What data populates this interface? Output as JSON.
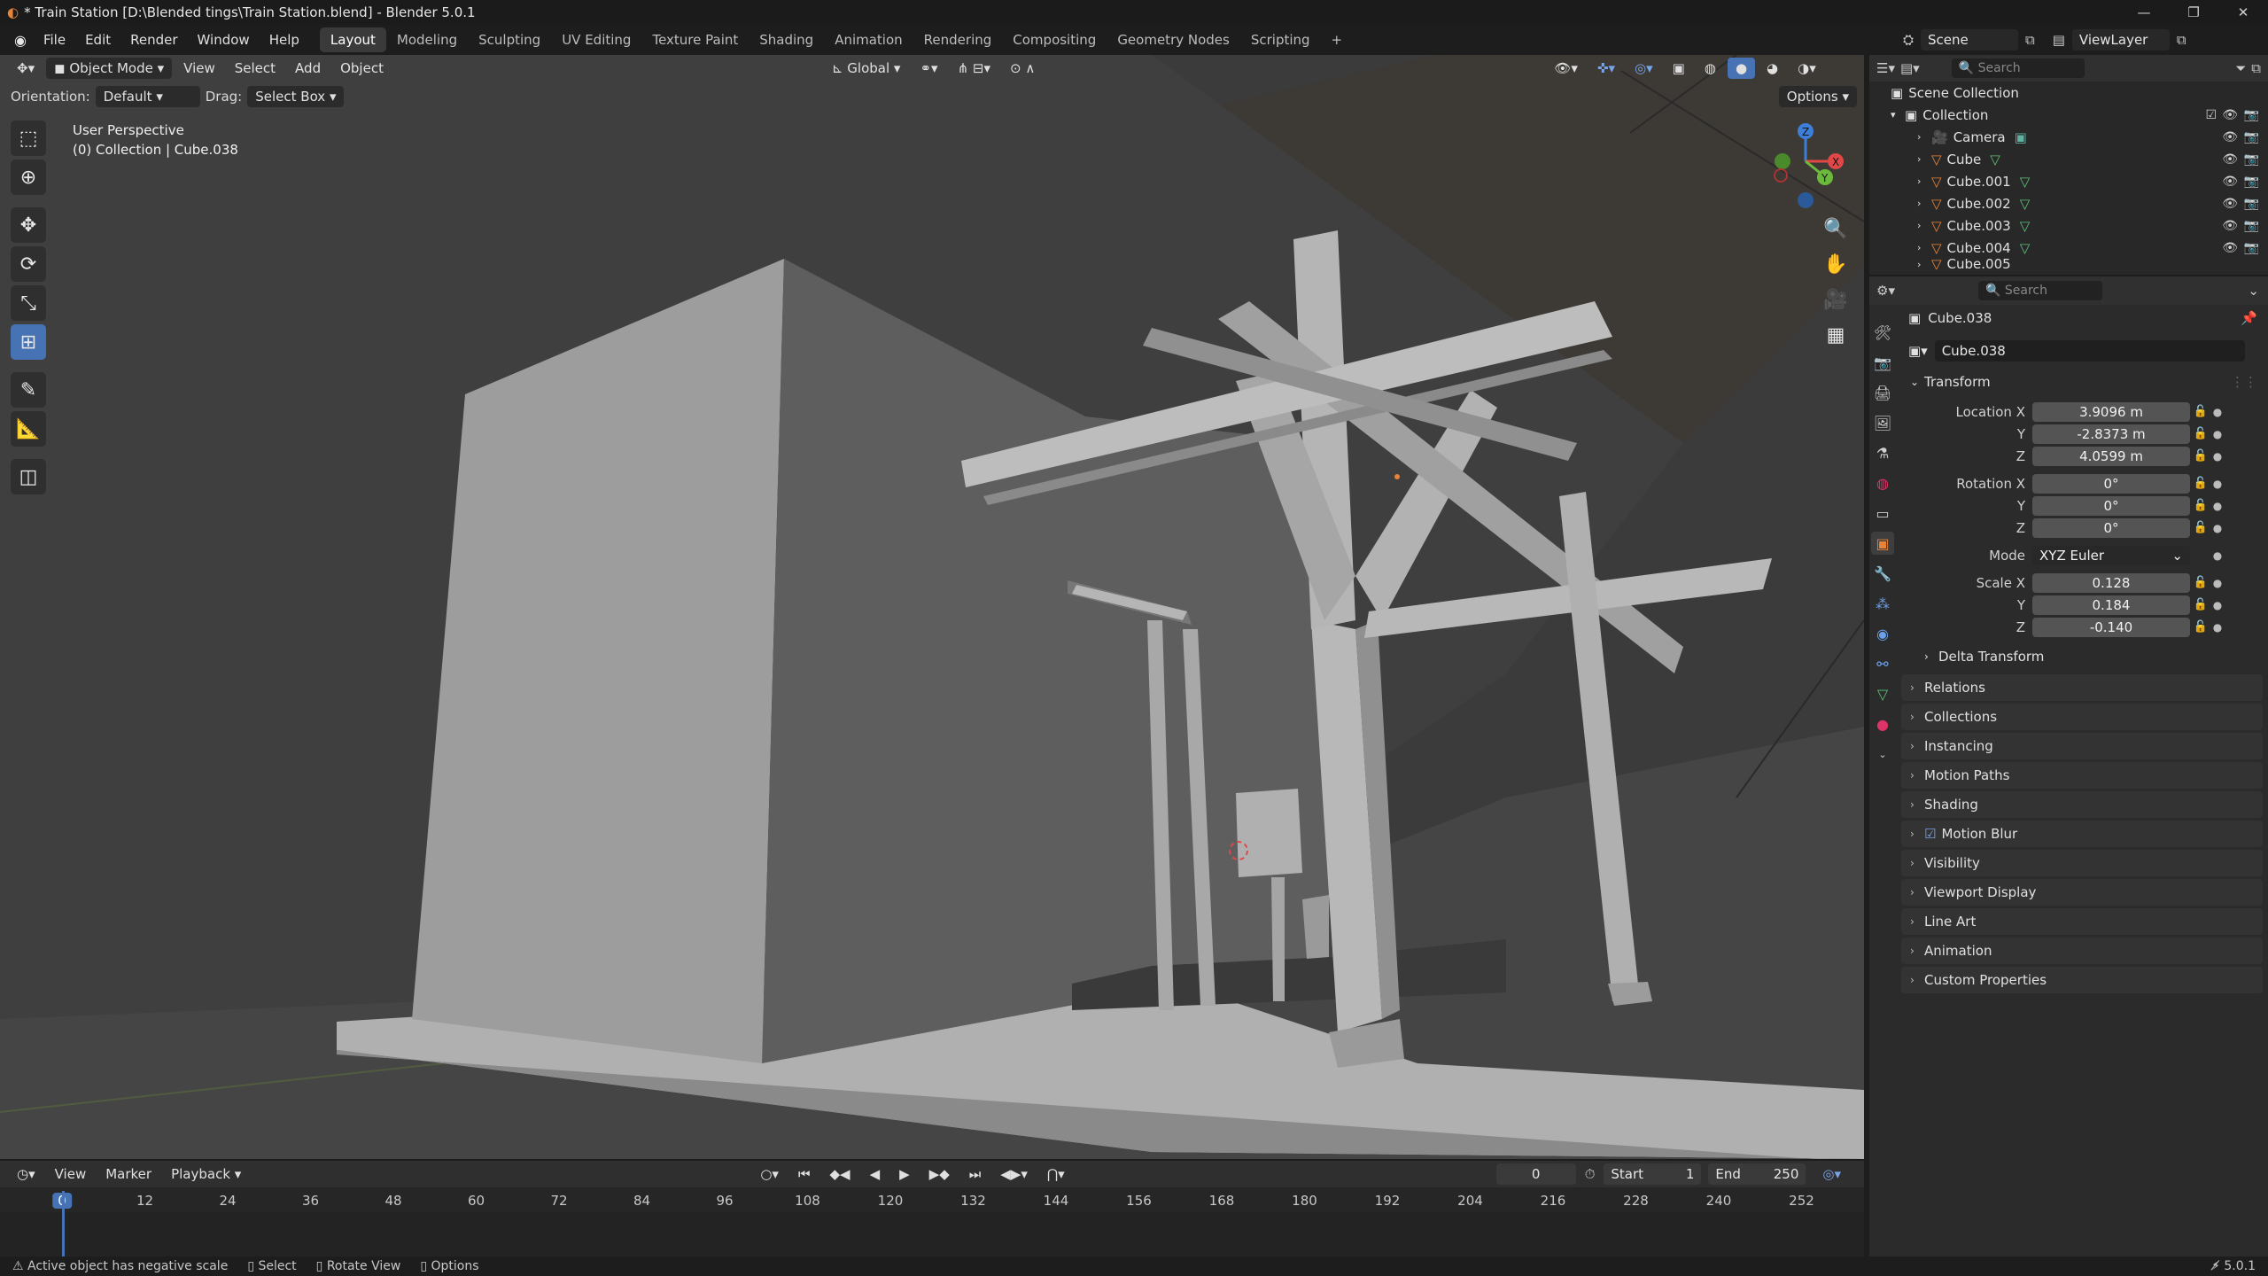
{
  "window": {
    "title": "* Train Station [D:\\Blended tings\\Train Station.blend] - Blender 5.0.1",
    "controls": [
      "—",
      "❐",
      "✕"
    ]
  },
  "menu": [
    "File",
    "Edit",
    "Render",
    "Window",
    "Help"
  ],
  "workspaces": [
    "Layout",
    "Modeling",
    "Sculpting",
    "UV Editing",
    "Texture Paint",
    "Shading",
    "Animation",
    "Rendering",
    "Compositing",
    "Geometry Nodes",
    "Scripting"
  ],
  "workspace_add": "+",
  "scene": {
    "name": "Scene",
    "view_layer": "ViewLayer"
  },
  "viewport": {
    "mode": "Object Mode",
    "menus": [
      "View",
      "Select",
      "Add",
      "Object"
    ],
    "transform_orientation": "Global",
    "orientation_label": "Orientation:",
    "orientation_value": "Default",
    "drag_label": "Drag:",
    "drag_value": "Select Box",
    "options": "Options",
    "perspective": "User Perspective",
    "active_info": "(0) Collection | Cube.038",
    "gizmo": {
      "x": "X",
      "y": "Y",
      "z": "Z"
    }
  },
  "outliner": {
    "search_placeholder": "Search",
    "scene_collection": "Scene Collection",
    "collection": "Collection",
    "items": [
      "Camera",
      "Cube",
      "Cube.001",
      "Cube.002",
      "Cube.003",
      "Cube.004",
      "Cube.005"
    ]
  },
  "properties": {
    "search_placeholder": "Search",
    "object_name": "Cube.038",
    "datablock": "Cube.038",
    "transform_title": "Transform",
    "location": {
      "label": "Location X",
      "x": "3.9096 m",
      "y": "-2.8373 m",
      "z": "4.0599 m"
    },
    "rotation": {
      "label": "Rotation X",
      "x": "0°",
      "y": "0°",
      "z": "0°"
    },
    "mode_label": "Mode",
    "mode_value": "XYZ Euler",
    "scale": {
      "label": "Scale X",
      "x": "0.128",
      "y": "0.184",
      "z": "-0.140"
    },
    "axis_y": "Y",
    "axis_z": "Z",
    "delta_transform": "Delta Transform",
    "panels": [
      "Relations",
      "Collections",
      "Instancing",
      "Motion Paths",
      "Shading",
      "Motion Blur",
      "Visibility",
      "Viewport Display",
      "Line Art",
      "Animation",
      "Custom Properties"
    ]
  },
  "timeline": {
    "menus": [
      "View",
      "Marker",
      "Playback"
    ],
    "current_frame": "0",
    "start_label": "Start",
    "start": "1",
    "end_label": "End",
    "end": "250",
    "ticks": [
      "0",
      "12",
      "24",
      "36",
      "48",
      "60",
      "72",
      "84",
      "96",
      "108",
      "120",
      "132",
      "144",
      "156",
      "168",
      "180",
      "192",
      "204",
      "216",
      "228",
      "240",
      "252"
    ]
  },
  "status": {
    "warning": "Active object has negative scale",
    "hints": [
      "Select",
      "Rotate View",
      "Options"
    ],
    "version": "5.0.1"
  },
  "colors": {
    "accent": "#4772b3",
    "object_orange": "#e8833a",
    "x_axis": "#e04848",
    "y_axis": "#6bba3c",
    "z_axis": "#3d7ed8"
  }
}
